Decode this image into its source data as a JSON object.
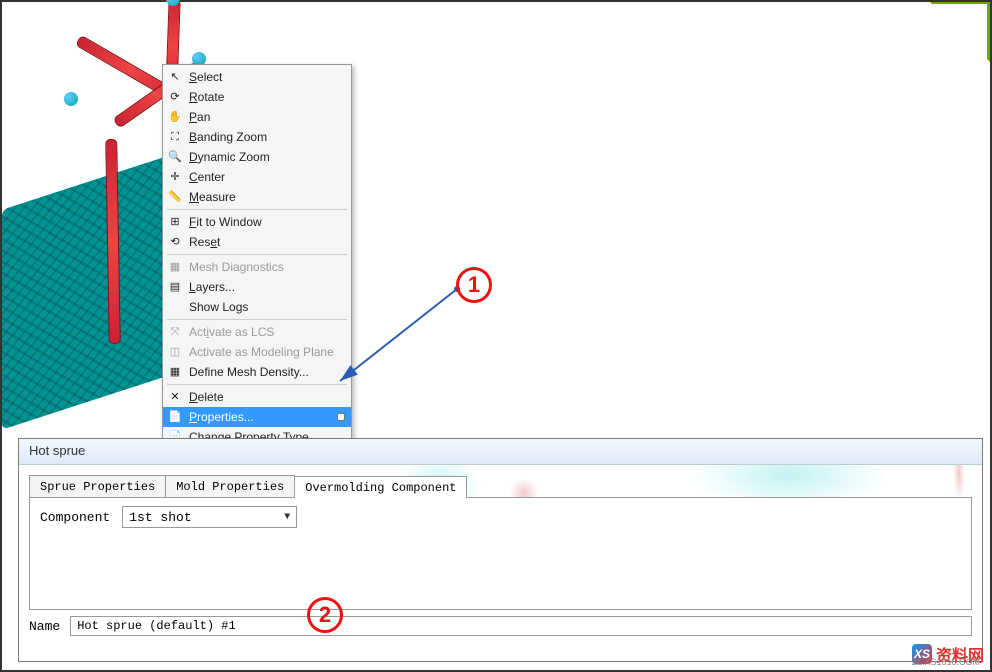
{
  "annotations": {
    "label1": "1",
    "label2": "2"
  },
  "context_menu": {
    "items": [
      {
        "icon": "↖",
        "label": "Select",
        "ul": 0,
        "en": true
      },
      {
        "icon": "⟳",
        "label": "Rotate",
        "ul": 0,
        "en": true
      },
      {
        "icon": "✋",
        "label": "Pan",
        "ul": 0,
        "en": true
      },
      {
        "icon": "⛶",
        "label": "Banding Zoom",
        "ul": 0,
        "en": true
      },
      {
        "icon": "🔍",
        "label": "Dynamic Zoom",
        "ul": 0,
        "en": true
      },
      {
        "icon": "✛",
        "label": "Center",
        "ul": 0,
        "en": true
      },
      {
        "icon": "📏",
        "label": "Measure",
        "ul": 0,
        "en": true
      },
      {
        "sep": true
      },
      {
        "icon": "⊞",
        "label": "Fit to Window",
        "ul": 0,
        "en": true
      },
      {
        "icon": "⟲",
        "label": "Reset",
        "ul": 3,
        "en": true
      },
      {
        "sep": true
      },
      {
        "icon": "▦",
        "label": "Mesh Diagnostics",
        "en": false
      },
      {
        "icon": "▤",
        "label": "Layers...",
        "ul": 0,
        "en": true
      },
      {
        "icon": "",
        "label": "Show Logs",
        "en": true
      },
      {
        "sep": true
      },
      {
        "icon": "⤧",
        "label": "Activate as LCS",
        "ul": 3,
        "en": false
      },
      {
        "icon": "◫",
        "label": "Activate as Modeling Plane",
        "en": false
      },
      {
        "icon": "▦",
        "label": "Define Mesh Density...",
        "en": true
      },
      {
        "sep": true
      },
      {
        "icon": "✕",
        "label": "Delete",
        "ul": 0,
        "en": true
      },
      {
        "icon": "📄",
        "label": "Properties...",
        "ul": 0,
        "en": true,
        "hl": true
      },
      {
        "icon": "📄",
        "label": "Change Property Type...",
        "en": true
      }
    ]
  },
  "dialog": {
    "title": "Hot sprue",
    "tabs": [
      "Sprue Properties",
      "Mold Properties",
      "Overmolding Component"
    ],
    "active_tab": 2,
    "component_label": "Component",
    "component_value": "1st shot",
    "name_label": "Name",
    "name_value": "Hot sprue (default) #1"
  },
  "watermark": {
    "brand": "资料网",
    "url": "ZL.XS1616.COM",
    "logo": "XS"
  }
}
